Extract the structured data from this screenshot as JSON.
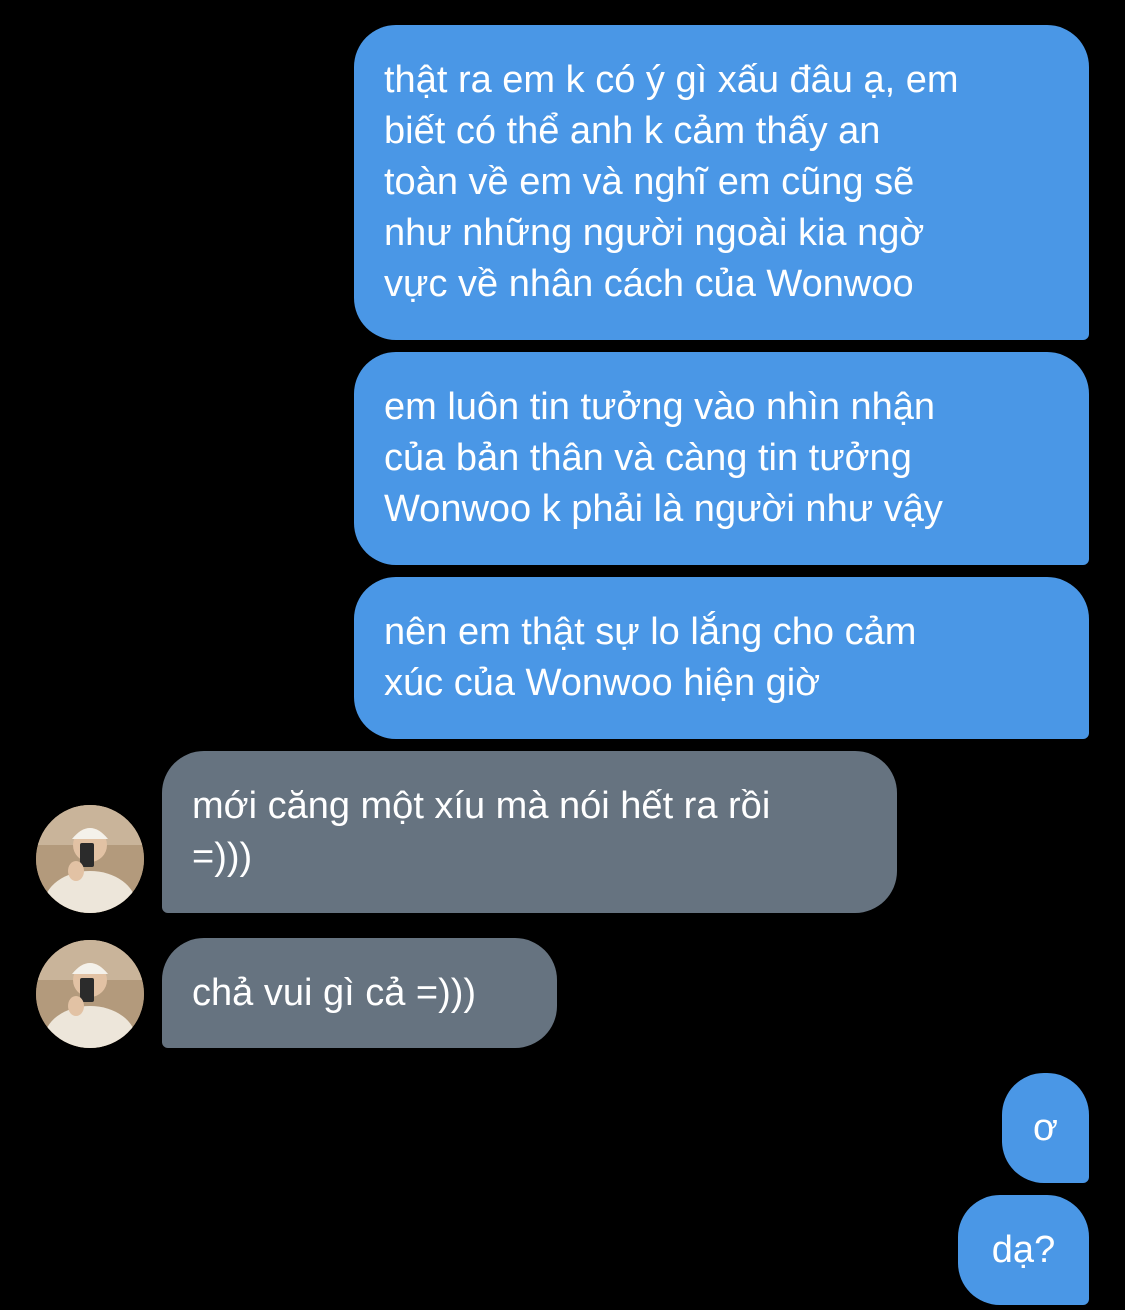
{
  "conversation": {
    "messages": [
      {
        "sender": "me",
        "text": "thật ra em k có ý gì xấu đâu ạ, em\nbiết có thể anh k cảm thấy an\ntoàn về em và nghĩ em cũng sẽ\nnhư những người ngoài kia ngờ\nvực về nhân cách của Wonwoo"
      },
      {
        "sender": "me",
        "text": "em luôn tin tưởng vào nhìn nhận\ncủa bản thân và càng tin tưởng\nWonwoo k phải là người như vậy"
      },
      {
        "sender": "me",
        "text": "nên em thật sự lo lắng cho cảm\nxúc của Wonwoo hiện giờ"
      },
      {
        "sender": "them",
        "text": "mới căng một xíu mà nói hết ra rồi\n=)))"
      },
      {
        "sender": "them",
        "text": "chả vui gì cả =)))"
      },
      {
        "sender": "me",
        "text": "ơ"
      },
      {
        "sender": "me",
        "text": "dạ?"
      }
    ]
  },
  "colors": {
    "background": "#000000",
    "sent_bubble": "#4a97e6",
    "received_bubble": "#667380",
    "text": "#ffffff"
  },
  "icons": {
    "contact_avatar": "avatar-photo"
  }
}
